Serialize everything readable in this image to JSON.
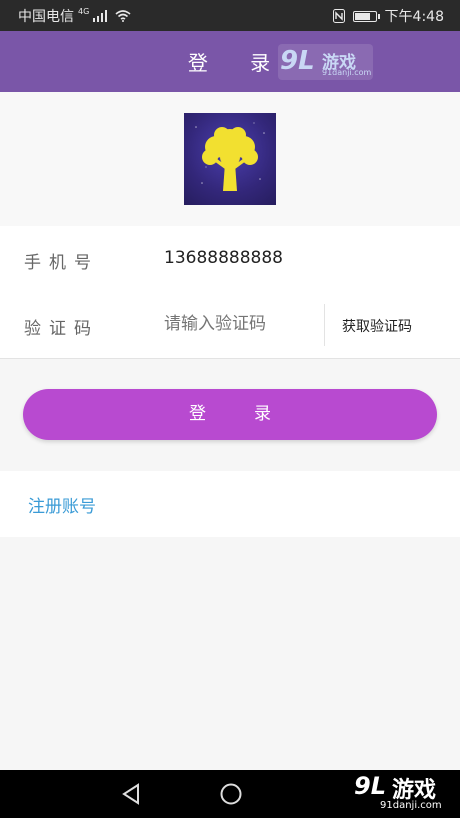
{
  "status_bar": {
    "carrier": "中国电信",
    "network": "4G",
    "time": "下午4:48",
    "battery_level": 0.7
  },
  "header": {
    "title": "登 录"
  },
  "watermark": {
    "logo": "9L",
    "name": "游戏",
    "url": "91danji.com"
  },
  "form": {
    "phone_label": "手机号",
    "phone_value": "13688888888",
    "code_label": "验证码",
    "code_placeholder": "请输入验证码",
    "get_code_label": "获取验证码"
  },
  "login_button": {
    "label": "登录"
  },
  "register": {
    "label": "注册账号"
  },
  "colors": {
    "header": "#7a56a8",
    "login_button": "#b84ad0",
    "register_link": "#3a9bd6"
  },
  "icons": {
    "logo": "tree-icon",
    "back": "back-triangle-icon",
    "home": "home-circle-icon"
  }
}
